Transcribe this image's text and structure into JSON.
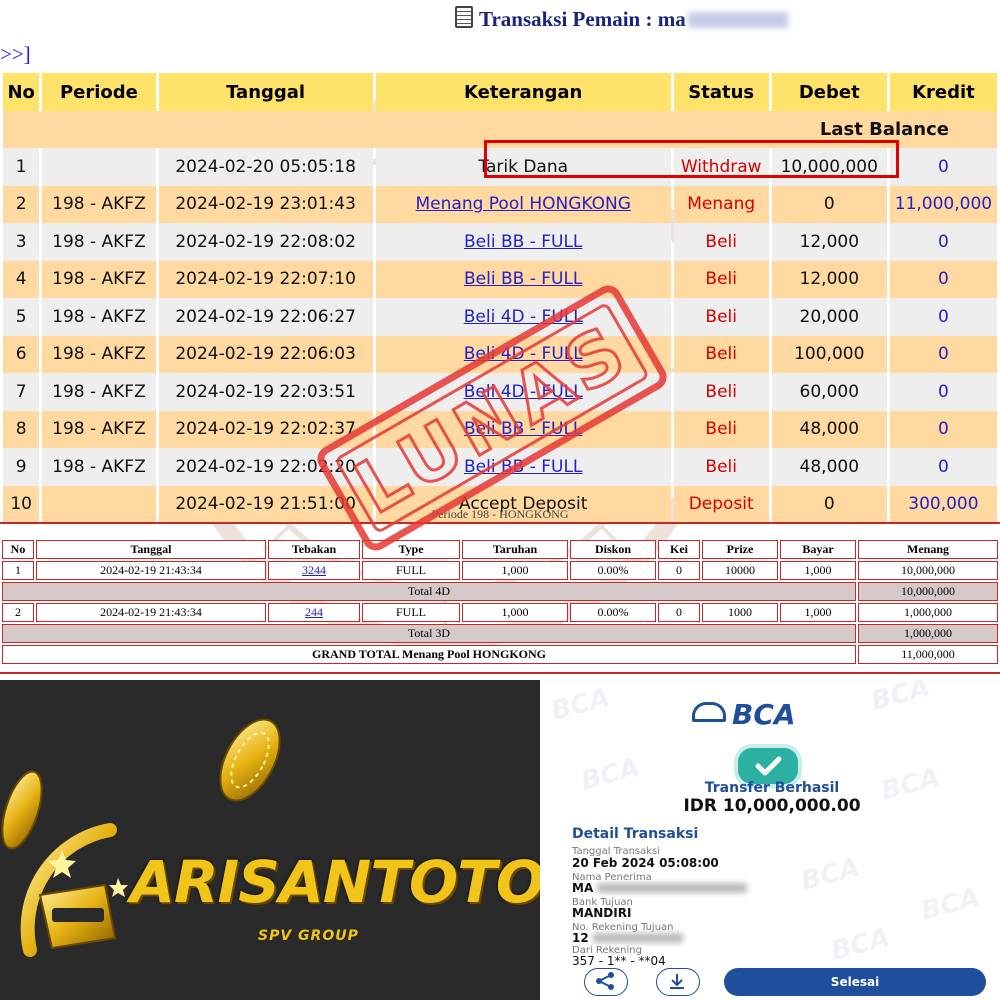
{
  "header": {
    "title": "Transaksi   Pemain : ma",
    "nav_link": ">>]"
  },
  "transactions": {
    "columns": [
      "No",
      "Periode",
      "Tanggal",
      "Keterangan",
      "Status",
      "Debet",
      "Kredit"
    ],
    "balance_label": "Last Balance",
    "rows": [
      {
        "no": "1",
        "periode": "",
        "tanggal": "2024-02-20 05:05:18",
        "keterangan": "Tarik Dana",
        "link": false,
        "status": "Withdraw",
        "debet": "10,000,000",
        "kredit": "0"
      },
      {
        "no": "2",
        "periode": "198 - AKFZ",
        "tanggal": "2024-02-19 23:01:43",
        "keterangan": "Menang Pool HONGKONG",
        "link": true,
        "status": "Menang",
        "debet": "0",
        "kredit": "11,000,000"
      },
      {
        "no": "3",
        "periode": "198 - AKFZ",
        "tanggal": "2024-02-19 22:08:02",
        "keterangan": "Beli BB - FULL",
        "link": true,
        "status": "Beli",
        "debet": "12,000",
        "kredit": "0"
      },
      {
        "no": "4",
        "periode": "198 - AKFZ",
        "tanggal": "2024-02-19 22:07:10",
        "keterangan": "Beli BB - FULL",
        "link": true,
        "status": "Beli",
        "debet": "12,000",
        "kredit": "0"
      },
      {
        "no": "5",
        "periode": "198 - AKFZ",
        "tanggal": "2024-02-19 22:06:27",
        "keterangan": "Beli 4D - FULL",
        "link": true,
        "status": "Beli",
        "debet": "20,000",
        "kredit": "0"
      },
      {
        "no": "6",
        "periode": "198 - AKFZ",
        "tanggal": "2024-02-19 22:06:03",
        "keterangan": "Beli 4D - FULL",
        "link": true,
        "status": "Beli",
        "debet": "100,000",
        "kredit": "0"
      },
      {
        "no": "7",
        "periode": "198 - AKFZ",
        "tanggal": "2024-02-19 22:03:51",
        "keterangan": "Beli 4D - FULL",
        "link": true,
        "status": "Beli",
        "debet": "60,000",
        "kredit": "0"
      },
      {
        "no": "8",
        "periode": "198 - AKFZ",
        "tanggal": "2024-02-19 22:02:37",
        "keterangan": "Beli BB - FULL",
        "link": true,
        "status": "Beli",
        "debet": "48,000",
        "kredit": "0"
      },
      {
        "no": "9",
        "periode": "198 - AKFZ",
        "tanggal": "2024-02-19 22:02:20",
        "keterangan": "Beli BB - FULL",
        "link": true,
        "status": "Beli",
        "debet": "48,000",
        "kredit": "0"
      },
      {
        "no": "10",
        "periode": "",
        "tanggal": "2024-02-19 21:51:00",
        "keterangan": "Accept Deposit",
        "link": false,
        "status": "Deposit",
        "debet": "0",
        "kredit": "300,000"
      }
    ]
  },
  "period_caption": "Periode 198 - HONGKONG",
  "detail": {
    "columns": [
      "No",
      "Tanggal",
      "Tebakan",
      "Type",
      "Taruhan",
      "Diskon",
      "Kei",
      "Prize",
      "Bayar",
      "Menang"
    ],
    "groups": [
      {
        "row": {
          "no": "1",
          "tanggal": "2024-02-19 21:43:34",
          "tebakan": "3244",
          "type": "FULL",
          "taruhan": "1,000",
          "diskon": "0.00%",
          "kei": "0",
          "prize": "10000",
          "bayar": "1,000",
          "menang": "10,000,000"
        },
        "total_label": "Total 4D",
        "total_value": "10,000,000"
      },
      {
        "row": {
          "no": "2",
          "tanggal": "2024-02-19 21:43:34",
          "tebakan": "244",
          "type": "FULL",
          "taruhan": "1,000",
          "diskon": "0.00%",
          "kei": "0",
          "prize": "1000",
          "bayar": "1,000",
          "menang": "1,000,000"
        },
        "total_label": "Total 3D",
        "total_value": "1,000,000"
      }
    ],
    "grand_total_label": "GRAND TOTAL  Menang Pool HONGKONG",
    "grand_total_value": "11,000,000"
  },
  "stamp_text": "LUNAS",
  "logo": {
    "brand": "ARISANTOTO",
    "sub": "SPV GROUP"
  },
  "receipt": {
    "bank_logo": "BCA",
    "status": "Transfer Berhasil",
    "amount": "IDR 10,000,000.00",
    "detail_title": "Detail Transaksi",
    "date_label": "Tanggal Transaksi",
    "date_value": "20 Feb 2024 05:08:00",
    "recipient_label": "Nama Penerima",
    "recipient_value": "MA",
    "bank_label": "Bank Tujuan",
    "bank_value": "MANDIRI",
    "account_label": "No. Rekening Tujuan",
    "account_value": "12",
    "source_label": "Dari Rekening",
    "source_value": "357 - 1** - **04",
    "done_button": "Selesai"
  },
  "colors": {
    "header_bg": "#ffe26a",
    "row_alt_bg": "#ffd9a0",
    "row_bg": "#eeeeee",
    "status_red": "#d40000",
    "link_blue": "#2222cc",
    "highlight_red": "#e00000",
    "bca_blue": "#1f4e9c",
    "logo_gold": "#f0c419",
    "logo_bg": "#2a2a2a"
  },
  "icons": [
    "document-icon",
    "check-icon",
    "share-icon",
    "download-icon",
    "coin-icon",
    "trophy-icon"
  ]
}
